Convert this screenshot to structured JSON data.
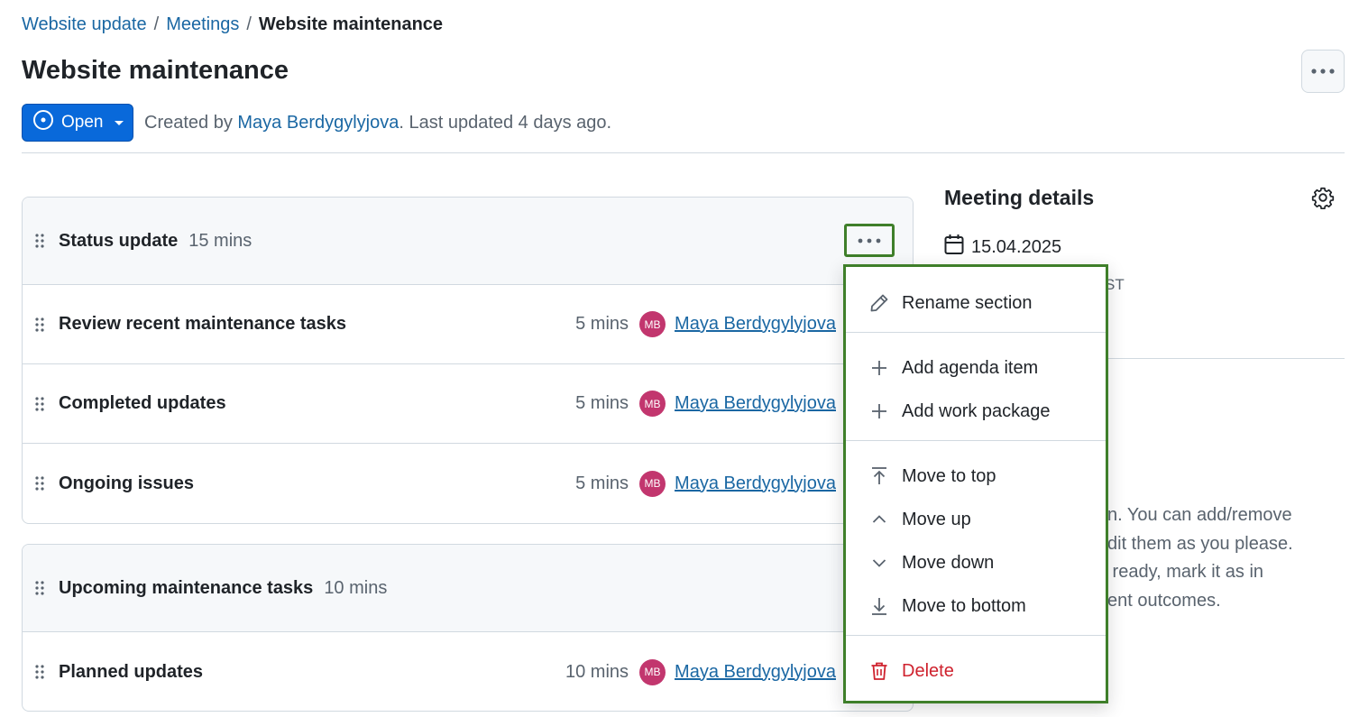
{
  "breadcrumb": {
    "items": [
      "Website update",
      "Meetings"
    ],
    "separator": "/",
    "current": "Website maintenance"
  },
  "page": {
    "title": "Website maintenance"
  },
  "status": {
    "label": "Open"
  },
  "meta": {
    "prefix": "Created by ",
    "author": "Maya Berdygylyjova",
    "suffix": ". Last updated 4 days ago."
  },
  "sections": [
    {
      "title": "Status update",
      "duration": "15 mins",
      "items": [
        {
          "title": "Review recent maintenance tasks",
          "duration": "5 mins",
          "initials": "MB",
          "presenter": "Maya Berdygylyjova"
        },
        {
          "title": "Completed updates",
          "duration": "5 mins",
          "initials": "MB",
          "presenter": "Maya Berdygylyjova"
        },
        {
          "title": "Ongoing issues",
          "duration": "5 mins",
          "initials": "MB",
          "presenter": "Maya Berdygylyjova"
        }
      ]
    },
    {
      "title": "Upcoming maintenance tasks",
      "duration": "10 mins",
      "items": [
        {
          "title": "Planned updates",
          "duration": "10 mins",
          "initials": "MB",
          "presenter": "Maya Berdygylyjova"
        }
      ]
    }
  ],
  "details": {
    "title": "Meeting details",
    "date": "15.04.2025",
    "time_fragment": "ST",
    "text_fragment": "n. You can add/remove\ndit them as you please.\n ready, mark it as in\nent outcomes."
  },
  "menu": {
    "rename": "Rename section",
    "add_agenda": "Add agenda item",
    "add_wp": "Add work package",
    "move_top": "Move to top",
    "move_up": "Move up",
    "move_down": "Move down",
    "move_bottom": "Move to bottom",
    "delete": "Delete"
  },
  "colors": {
    "accent": "#0969da",
    "link": "#1a67a3",
    "avatar": "#c2366e",
    "danger": "#cf222e",
    "highlight": "#3f7f2a"
  }
}
